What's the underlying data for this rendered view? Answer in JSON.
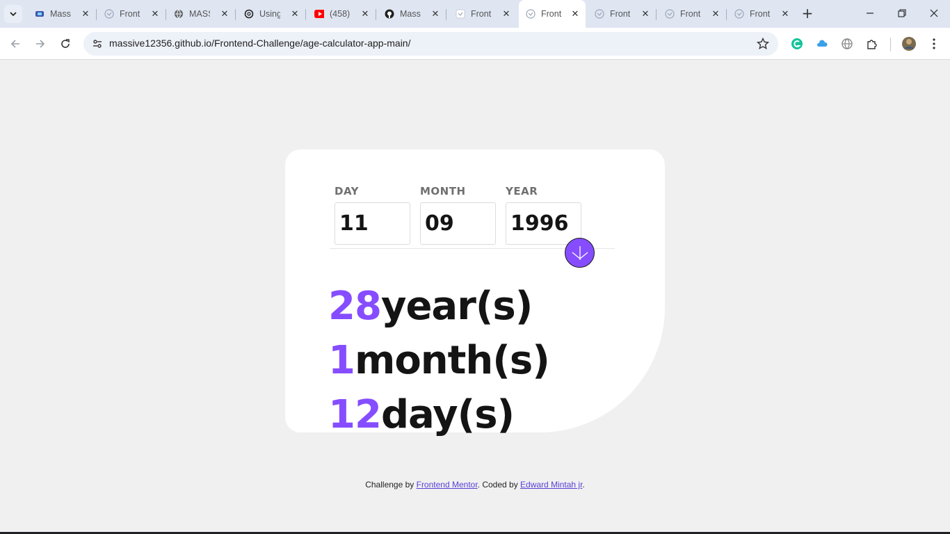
{
  "browser": {
    "tabs": [
      {
        "title": "Massi",
        "icon": "frontend-mentor-icon",
        "active": false
      },
      {
        "title": "Front",
        "icon": "site-favicon-icon",
        "active": false
      },
      {
        "title": "MASS",
        "icon": "globe-icon",
        "active": false
      },
      {
        "title": "Using",
        "icon": "openai-icon",
        "active": false
      },
      {
        "title": "(458)",
        "icon": "youtube-icon",
        "active": false
      },
      {
        "title": "Massi",
        "icon": "github-icon",
        "active": false
      },
      {
        "title": "Front",
        "icon": "site-favicon-icon",
        "active": false
      },
      {
        "title": "Front",
        "icon": "site-favicon-icon",
        "active": true
      },
      {
        "title": "Front",
        "icon": "site-favicon-icon",
        "active": false
      },
      {
        "title": "Front",
        "icon": "site-favicon-icon",
        "active": false
      },
      {
        "title": "Front",
        "icon": "site-favicon-icon",
        "active": false
      }
    ],
    "url": "massive12356.github.io/Frontend-Challenge/age-calculator-app-main/"
  },
  "form": {
    "day": {
      "label": "DAY",
      "value": "11"
    },
    "month": {
      "label": "MONTH",
      "value": "09"
    },
    "year": {
      "label": "YEAR",
      "value": "1996"
    }
  },
  "results": {
    "years": {
      "value": "28",
      "unit": "year(s)"
    },
    "months": {
      "value": "1",
      "unit": "month(s)"
    },
    "days": {
      "value": "12",
      "unit": "day(s)"
    }
  },
  "footer": {
    "prefix": "Challenge by ",
    "link1": "Frontend Mentor",
    "middle": ". Coded by ",
    "link2": "Edward Mintah jr",
    "suffix": "."
  },
  "colors": {
    "accent": "#854dff",
    "background": "#f0f0f0",
    "card": "#ffffff"
  }
}
